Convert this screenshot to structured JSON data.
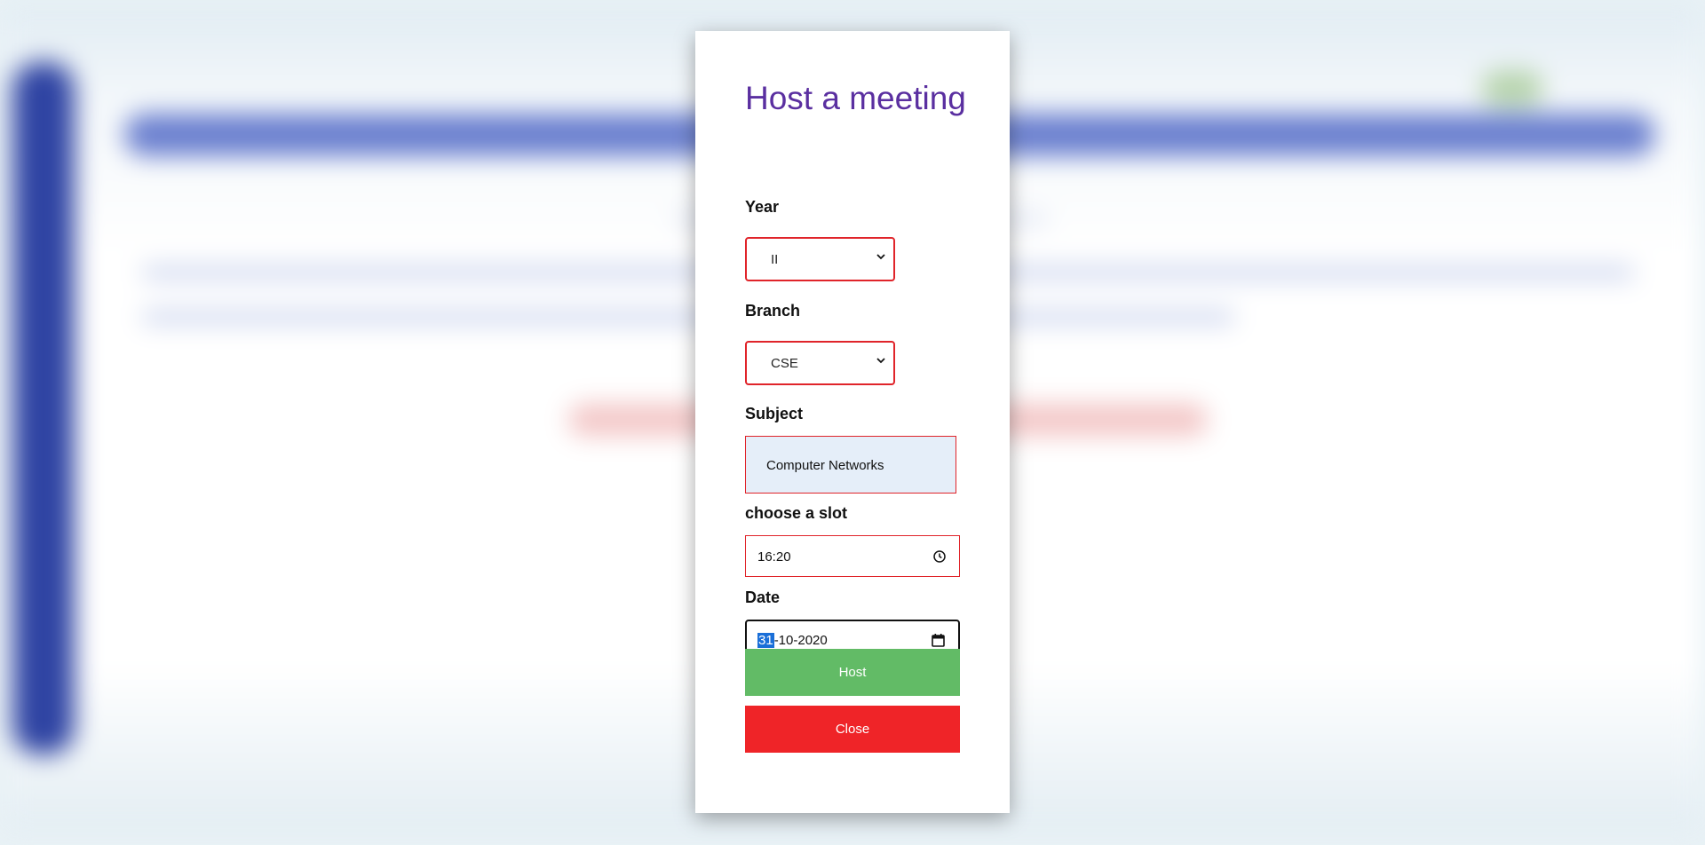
{
  "modal": {
    "title": "Host a meeting",
    "year": {
      "label": "Year",
      "value": "II"
    },
    "branch": {
      "label": "Branch",
      "value": "CSE"
    },
    "subject": {
      "label": "Subject",
      "value": "Computer Networks"
    },
    "slot": {
      "label": "choose a slot",
      "value": "16:20"
    },
    "date": {
      "label": "Date",
      "day": "31",
      "rest": "-10-2020"
    },
    "host_button": "Host",
    "close_button": "Close"
  },
  "colors": {
    "title": "#5a2fa0",
    "invalid_border": "#e0242a",
    "host": "#62bb66",
    "close": "#ef2428",
    "sidebar": "#2f44a3",
    "navbar": "#6a7fcf"
  },
  "icons": [
    "chevron-down-icon",
    "clock-icon",
    "calendar-icon"
  ]
}
